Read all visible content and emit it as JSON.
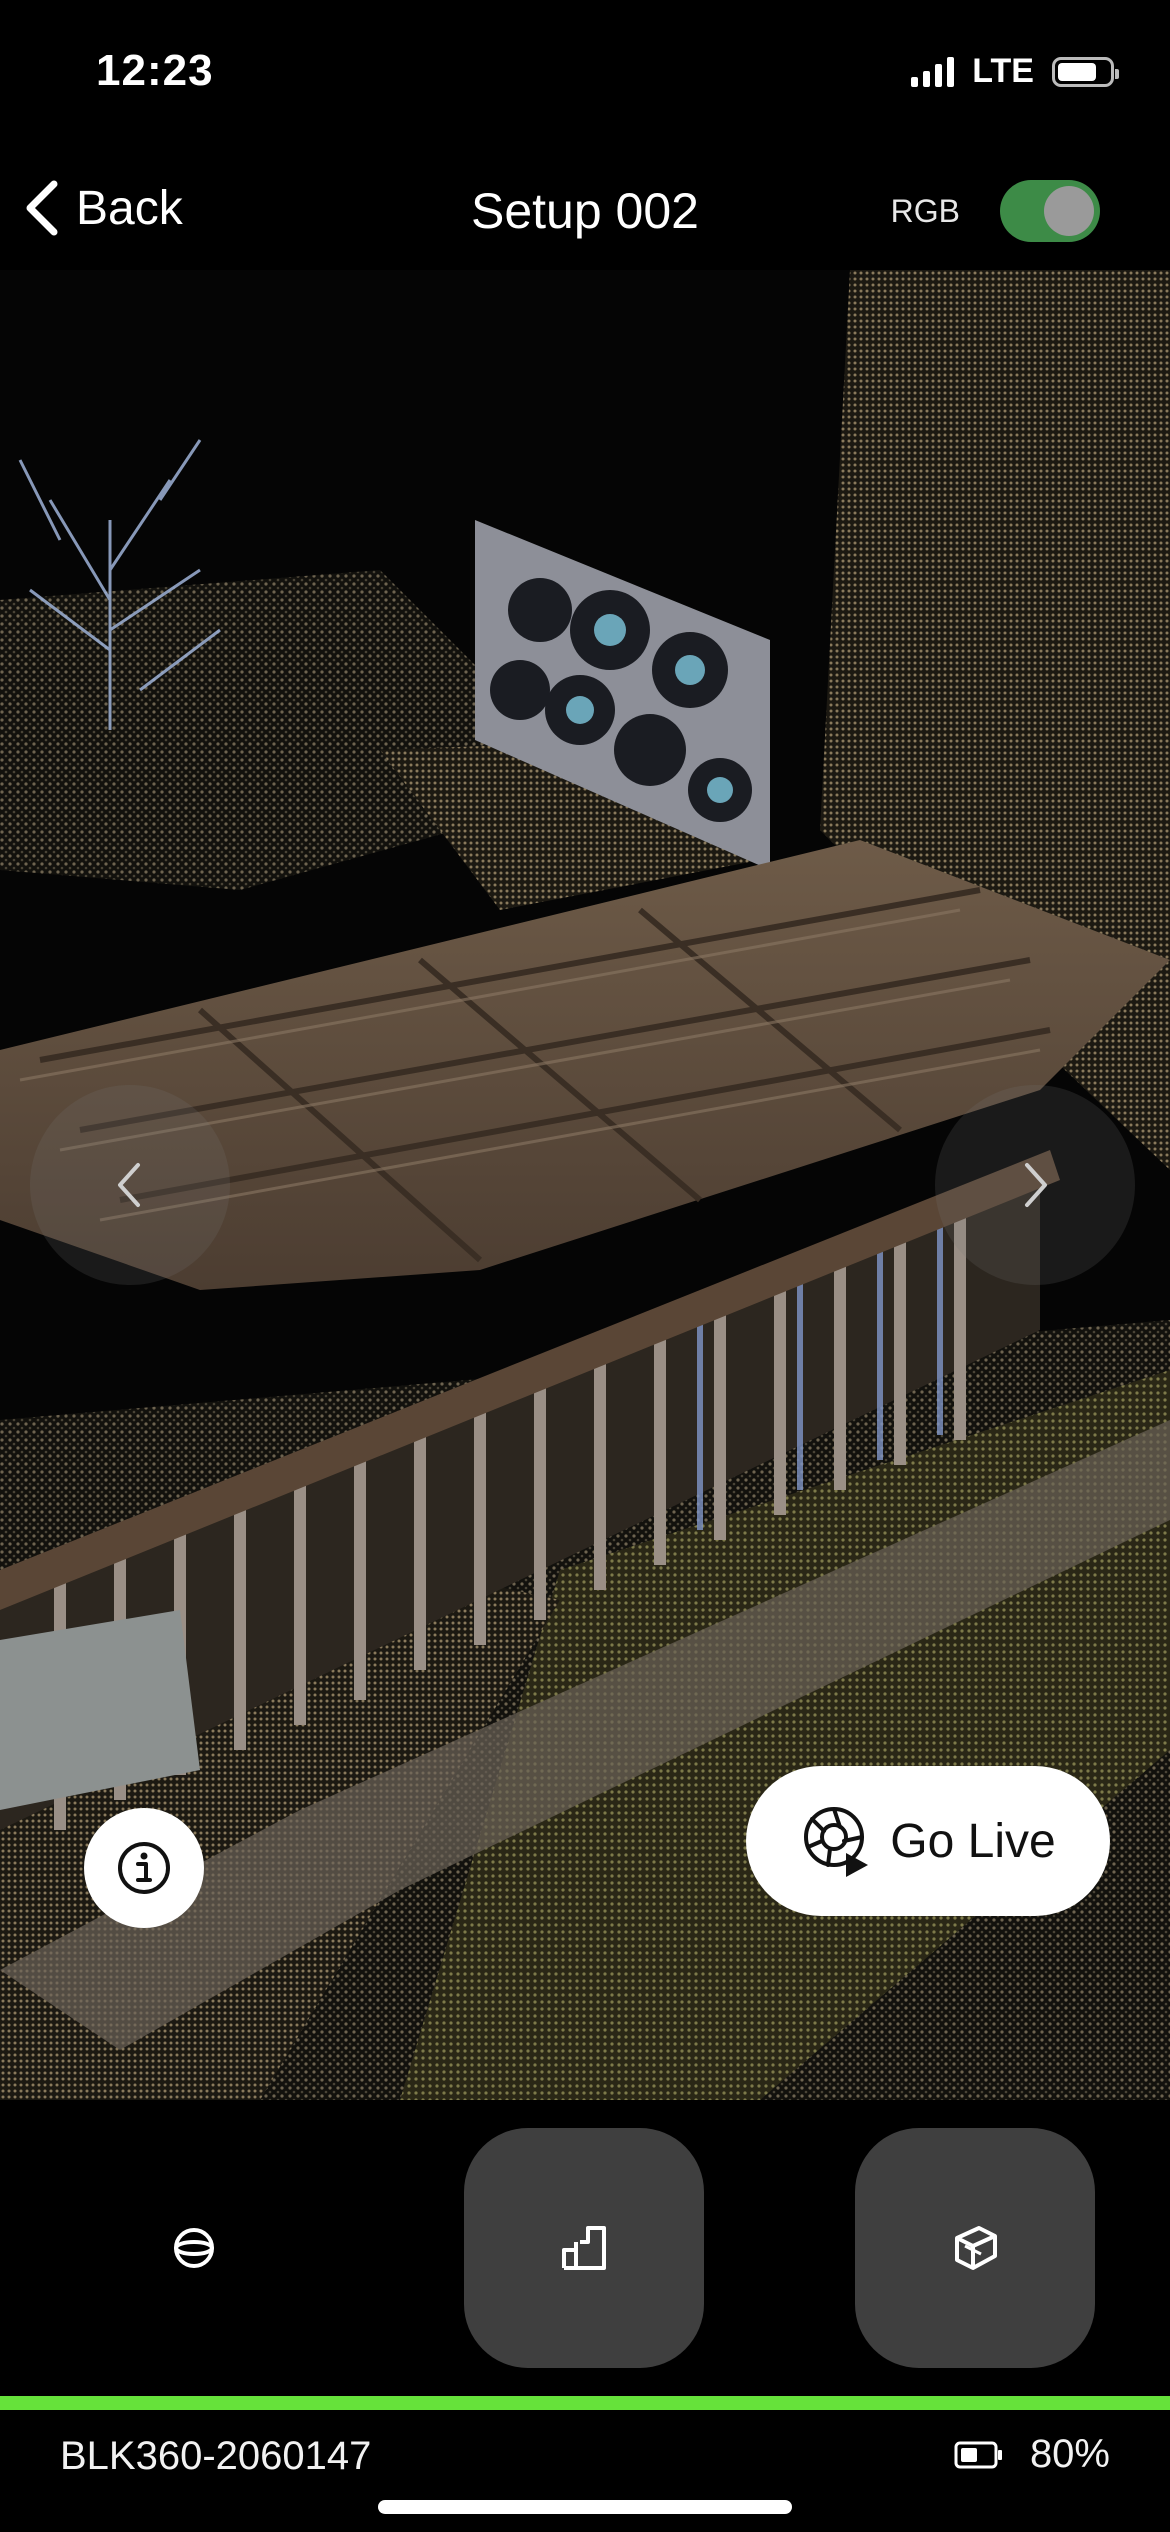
{
  "status": {
    "time": "12:23",
    "network": "LTE",
    "icons": [
      "signal-bars-icon",
      "battery-icon"
    ]
  },
  "nav": {
    "back_label": "Back",
    "title": "Setup 002",
    "rgb_label": "RGB",
    "rgb_enabled": true,
    "back_icon": "chevron-left-icon"
  },
  "viewer": {
    "content": "3D point cloud scan",
    "prev_icon": "chevron-left-icon",
    "next_icon": "chevron-right-icon",
    "info_icon": "info-icon",
    "go_live_label": "Go Live",
    "go_live_icon": "live-camera-icon"
  },
  "toolbar": {
    "tools": [
      {
        "icon": "orbit-view-icon",
        "active": false
      },
      {
        "icon": "floorplan-view-icon",
        "active": true
      },
      {
        "icon": "box-view-icon",
        "active": true
      }
    ]
  },
  "progress": {
    "value": 1.0,
    "color": "#66e23a"
  },
  "footer": {
    "device_id": "BLK360-2060147",
    "battery_percent": "80%",
    "battery_icon": "device-battery-icon"
  },
  "colors": {
    "toggle_on": "#3d8b47",
    "accent_green": "#66e23a",
    "tool_bg": "#3f3f3f"
  }
}
